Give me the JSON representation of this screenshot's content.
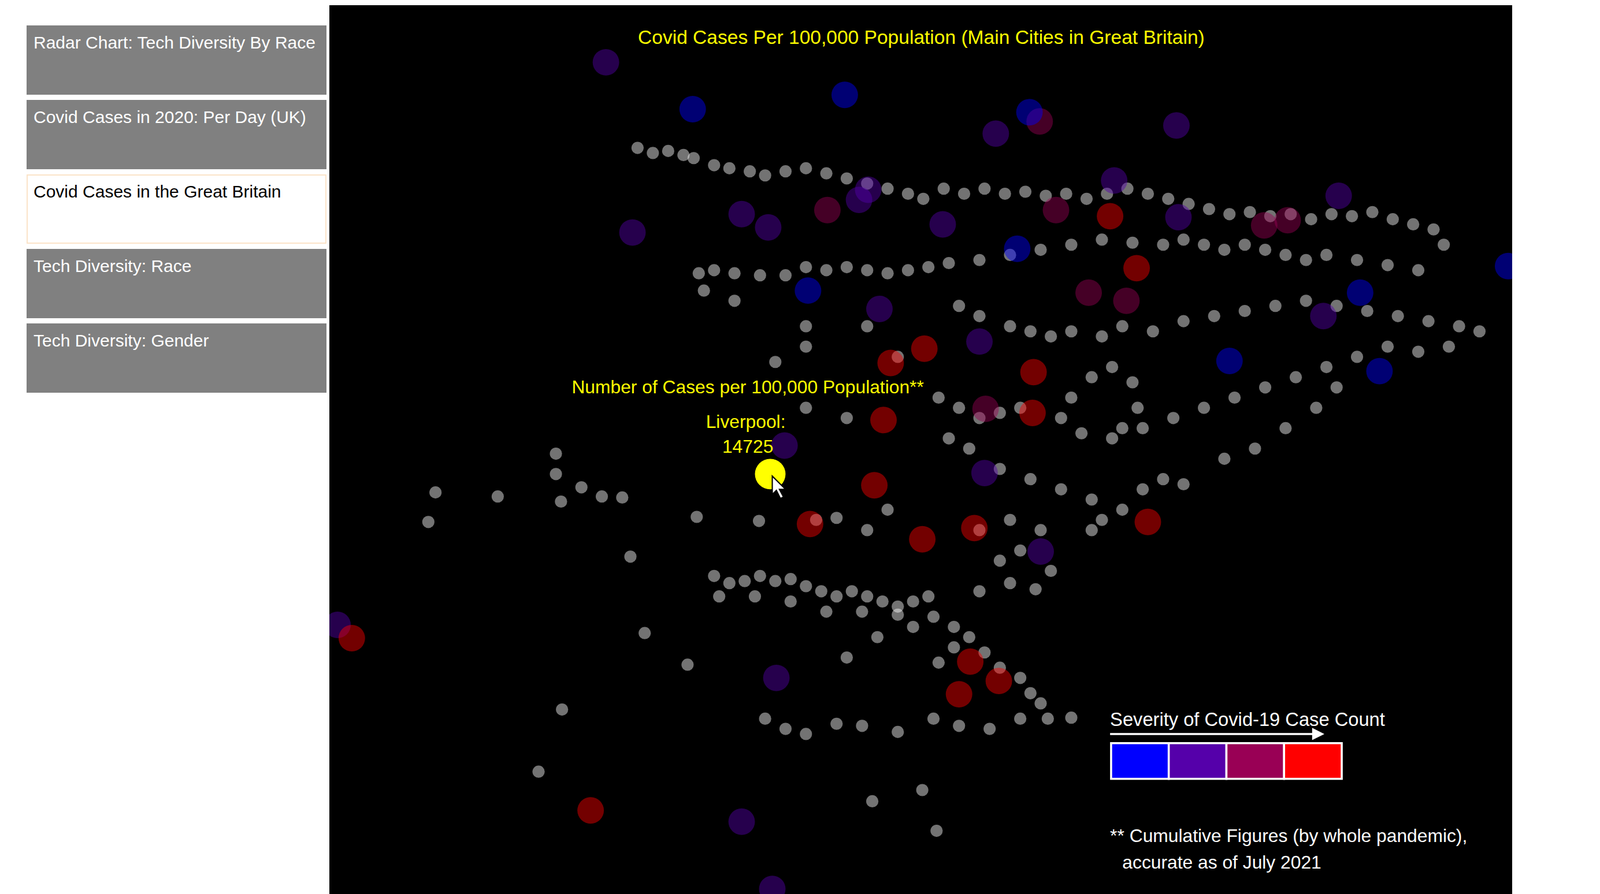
{
  "sidebar": {
    "items": [
      {
        "label": "Radar Chart: Tech Diversity By Race",
        "selected": false
      },
      {
        "label": "Covid Cases in 2020: Per Day (UK)",
        "selected": false
      },
      {
        "label": "Covid Cases in the Great Britain",
        "selected": true
      },
      {
        "label": "Tech Diversity: Race",
        "selected": false
      },
      {
        "label": "Tech Diversity: Gender",
        "selected": false
      }
    ]
  },
  "map": {
    "title": "Covid Cases Per 100,000 Population (Main Cities in Great Britain)",
    "tooltip": {
      "heading": "Number of Cases per 100,000 Population**",
      "city": "Liverpool:",
      "value": "14725",
      "point": [
        755,
        465
      ]
    },
    "towns": [
      [
        625,
        145
      ],
      [
        640,
        150
      ],
      [
        655,
        148
      ],
      [
        670,
        152
      ],
      [
        680,
        155
      ],
      [
        700,
        162
      ],
      [
        715,
        165
      ],
      [
        735,
        168
      ],
      [
        750,
        172
      ],
      [
        770,
        168
      ],
      [
        790,
        165
      ],
      [
        810,
        170
      ],
      [
        830,
        175
      ],
      [
        850,
        180
      ],
      [
        870,
        185
      ],
      [
        890,
        190
      ],
      [
        905,
        195
      ],
      [
        925,
        185
      ],
      [
        945,
        190
      ],
      [
        965,
        185
      ],
      [
        985,
        190
      ],
      [
        1005,
        188
      ],
      [
        1025,
        192
      ],
      [
        1045,
        190
      ],
      [
        1065,
        195
      ],
      [
        1085,
        190
      ],
      [
        1105,
        185
      ],
      [
        1125,
        190
      ],
      [
        1145,
        195
      ],
      [
        1165,
        200
      ],
      [
        1185,
        205
      ],
      [
        1205,
        210
      ],
      [
        1225,
        208
      ],
      [
        1245,
        212
      ],
      [
        1265,
        210
      ],
      [
        1285,
        215
      ],
      [
        1305,
        210
      ],
      [
        1325,
        212
      ],
      [
        1345,
        208
      ],
      [
        1365,
        215
      ],
      [
        1385,
        220
      ],
      [
        1405,
        225
      ],
      [
        1415,
        240
      ],
      [
        685,
        268
      ],
      [
        700,
        265
      ],
      [
        720,
        268
      ],
      [
        770,
        270
      ],
      [
        790,
        262
      ],
      [
        810,
        265
      ],
      [
        830,
        262
      ],
      [
        850,
        265
      ],
      [
        870,
        268
      ],
      [
        890,
        265
      ],
      [
        910,
        262
      ],
      [
        930,
        258
      ],
      [
        960,
        255
      ],
      [
        990,
        250
      ],
      [
        1020,
        245
      ],
      [
        1050,
        240
      ],
      [
        1080,
        235
      ],
      [
        1110,
        238
      ],
      [
        1140,
        240
      ],
      [
        1160,
        235
      ],
      [
        1180,
        240
      ],
      [
        1200,
        245
      ],
      [
        1220,
        240
      ],
      [
        1240,
        245
      ],
      [
        1260,
        250
      ],
      [
        1280,
        255
      ],
      [
        1300,
        250
      ],
      [
        1330,
        255
      ],
      [
        1360,
        260
      ],
      [
        1390,
        265
      ],
      [
        940,
        300
      ],
      [
        960,
        310
      ],
      [
        990,
        320
      ],
      [
        1010,
        325
      ],
      [
        1030,
        330
      ],
      [
        1050,
        325
      ],
      [
        1080,
        330
      ],
      [
        1100,
        320
      ],
      [
        1130,
        325
      ],
      [
        1160,
        315
      ],
      [
        1190,
        310
      ],
      [
        1220,
        305
      ],
      [
        1250,
        300
      ],
      [
        1280,
        295
      ],
      [
        1310,
        300
      ],
      [
        1340,
        305
      ],
      [
        1370,
        310
      ],
      [
        1400,
        315
      ],
      [
        1430,
        320
      ],
      [
        1450,
        325
      ],
      [
        1420,
        340
      ],
      [
        1390,
        345
      ],
      [
        1360,
        340
      ],
      [
        1330,
        350
      ],
      [
        1300,
        360
      ],
      [
        1270,
        370
      ],
      [
        1240,
        380
      ],
      [
        1210,
        390
      ],
      [
        1180,
        400
      ],
      [
        1150,
        410
      ],
      [
        1120,
        420
      ],
      [
        1090,
        430
      ],
      [
        1060,
        425
      ],
      [
        1040,
        410
      ],
      [
        1050,
        390
      ],
      [
        1070,
        370
      ],
      [
        1090,
        360
      ],
      [
        1110,
        375
      ],
      [
        1115,
        400
      ],
      [
        1100,
        420
      ],
      [
        920,
        390
      ],
      [
        940,
        400
      ],
      [
        960,
        410
      ],
      [
        980,
        405
      ],
      [
        1000,
        400
      ],
      [
        930,
        430
      ],
      [
        950,
        440
      ],
      [
        980,
        460
      ],
      [
        1010,
        470
      ],
      [
        1040,
        480
      ],
      [
        1070,
        490
      ],
      [
        1080,
        510
      ],
      [
        1070,
        520
      ],
      [
        1100,
        500
      ],
      [
        1120,
        480
      ],
      [
        1140,
        470
      ],
      [
        1160,
        475
      ],
      [
        1200,
        450
      ],
      [
        1230,
        440
      ],
      [
        1260,
        420
      ],
      [
        1290,
        400
      ],
      [
        1310,
        380
      ],
      [
        745,
        270
      ],
      [
        720,
        295
      ],
      [
        690,
        285
      ],
      [
        790,
        320
      ],
      [
        790,
        340
      ],
      [
        850,
        320
      ],
      [
        880,
        350
      ],
      [
        760,
        355
      ],
      [
        790,
        400
      ],
      [
        830,
        410
      ],
      [
        545,
        445
      ],
      [
        545,
        465
      ],
      [
        570,
        478
      ],
      [
        590,
        487
      ],
      [
        610,
        488
      ],
      [
        550,
        492
      ],
      [
        427,
        483
      ],
      [
        488,
        487
      ],
      [
        420,
        512
      ],
      [
        618,
        546
      ],
      [
        683,
        507
      ],
      [
        744,
        511
      ],
      [
        800,
        510
      ],
      [
        820,
        508
      ],
      [
        850,
        520
      ],
      [
        870,
        500
      ],
      [
        700,
        565
      ],
      [
        715,
        572
      ],
      [
        730,
        570
      ],
      [
        745,
        565
      ],
      [
        760,
        570
      ],
      [
        775,
        568
      ],
      [
        790,
        575
      ],
      [
        805,
        580
      ],
      [
        820,
        585
      ],
      [
        835,
        580
      ],
      [
        850,
        585
      ],
      [
        865,
        590
      ],
      [
        880,
        595
      ],
      [
        895,
        590
      ],
      [
        910,
        585
      ],
      [
        705,
        585
      ],
      [
        740,
        585
      ],
      [
        775,
        590
      ],
      [
        810,
        600
      ],
      [
        845,
        600
      ],
      [
        880,
        603
      ],
      [
        915,
        605
      ],
      [
        935,
        615
      ],
      [
        950,
        625
      ],
      [
        965,
        640
      ],
      [
        980,
        655
      ],
      [
        1000,
        665
      ],
      [
        1010,
        680
      ],
      [
        1020,
        690
      ],
      [
        935,
        635
      ],
      [
        920,
        650
      ],
      [
        632,
        621
      ],
      [
        674,
        652
      ],
      [
        551,
        696
      ],
      [
        528,
        757
      ],
      [
        750,
        705
      ],
      [
        770,
        715
      ],
      [
        790,
        720
      ],
      [
        820,
        710
      ],
      [
        845,
        712
      ],
      [
        880,
        718
      ],
      [
        915,
        705
      ],
      [
        940,
        712
      ],
      [
        970,
        715
      ],
      [
        1000,
        705
      ],
      [
        1027,
        705
      ],
      [
        1050,
        704
      ],
      [
        855,
        786
      ],
      [
        904,
        775
      ],
      [
        918,
        815
      ],
      [
        830,
        645
      ],
      [
        860,
        625
      ],
      [
        895,
        615
      ],
      [
        960,
        580
      ],
      [
        990,
        572
      ],
      [
        1015,
        578
      ],
      [
        1030,
        560
      ],
      [
        960,
        520
      ],
      [
        990,
        510
      ],
      [
        1020,
        520
      ],
      [
        1000,
        540
      ],
      [
        980,
        550
      ]
    ],
    "cities": [
      {
        "point": [
          594,
          61
        ],
        "color": "#5500aa"
      },
      {
        "point": [
          679,
          107
        ],
        "color": "#0000ff"
      },
      {
        "point": [
          828,
          93
        ],
        "color": "#0000ff"
      },
      {
        "point": [
          976,
          131
        ],
        "color": "#5500aa"
      },
      {
        "point": [
          1019,
          119
        ],
        "color": "#990055"
      },
      {
        "point": [
          1009,
          110
        ],
        "color": "#0000ff"
      },
      {
        "point": [
          1153,
          123
        ],
        "color": "#5500aa"
      },
      {
        "point": [
          620,
          228
        ],
        "color": "#5500aa"
      },
      {
        "point": [
          727,
          210
        ],
        "color": "#5500aa"
      },
      {
        "point": [
          753,
          223
        ],
        "color": "#5500aa"
      },
      {
        "point": [
          811,
          206
        ],
        "color": "#990055"
      },
      {
        "point": [
          842,
          196
        ],
        "color": "#5500aa"
      },
      {
        "point": [
          851,
          186
        ],
        "color": "#5500aa"
      },
      {
        "point": [
          924,
          220
        ],
        "color": "#5500aa"
      },
      {
        "point": [
          1035,
          206
        ],
        "color": "#990055"
      },
      {
        "point": [
          1088,
          212
        ],
        "color": "#ff0000"
      },
      {
        "point": [
          1155,
          213
        ],
        "color": "#5500aa"
      },
      {
        "point": [
          1239,
          221
        ],
        "color": "#990055"
      },
      {
        "point": [
          1262,
          216
        ],
        "color": "#990055"
      },
      {
        "point": [
          1312,
          192
        ],
        "color": "#5500aa"
      },
      {
        "point": [
          1092,
          177
        ],
        "color": "#5500aa"
      },
      {
        "point": [
          1114,
          263
        ],
        "color": "#ff0000"
      },
      {
        "point": [
          1104,
          295
        ],
        "color": "#990055"
      },
      {
        "point": [
          1067,
          287
        ],
        "color": "#990055"
      },
      {
        "point": [
          997,
          244
        ],
        "color": "#0000ff"
      },
      {
        "point": [
          792,
          285
        ],
        "color": "#0000ff"
      },
      {
        "point": [
          862,
          303
        ],
        "color": "#5500aa"
      },
      {
        "point": [
          873,
          356
        ],
        "color": "#ff0000"
      },
      {
        "point": [
          906,
          342
        ],
        "color": "#ff0000"
      },
      {
        "point": [
          960,
          335
        ],
        "color": "#5500aa"
      },
      {
        "point": [
          1013,
          365
        ],
        "color": "#ff0000"
      },
      {
        "point": [
          1012,
          405
        ],
        "color": "#ff0000"
      },
      {
        "point": [
          966,
          401
        ],
        "color": "#990055"
      },
      {
        "point": [
          866,
          412
        ],
        "color": "#ff0000"
      },
      {
        "point": [
          769,
          437
        ],
        "color": "#5500aa"
      },
      {
        "point": [
          857,
          476
        ],
        "color": "#ff0000"
      },
      {
        "point": [
          794,
          514
        ],
        "color": "#ff0000"
      },
      {
        "point": [
          904,
          529
        ],
        "color": "#ff0000"
      },
      {
        "point": [
          955,
          518
        ],
        "color": "#ff0000"
      },
      {
        "point": [
          965,
          464
        ],
        "color": "#5500aa"
      },
      {
        "point": [
          1125,
          512
        ],
        "color": "#ff0000"
      },
      {
        "point": [
          1020,
          541
        ],
        "color": "#5500aa"
      },
      {
        "point": [
          1333,
          287
        ],
        "color": "#0000ff"
      },
      {
        "point": [
          1297,
          310
        ],
        "color": "#5500aa"
      },
      {
        "point": [
          1352,
          364
        ],
        "color": "#0000ff"
      },
      {
        "point": [
          1205,
          354
        ],
        "color": "#0000ff"
      },
      {
        "point": [
          1478,
          261
        ],
        "color": "#0000ff"
      },
      {
        "point": [
          331,
          613
        ],
        "color": "#5500aa"
      },
      {
        "point": [
          345,
          626
        ],
        "color": "#ff0000"
      },
      {
        "point": [
          761,
          665
        ],
        "color": "#5500aa"
      },
      {
        "point": [
          951,
          649
        ],
        "color": "#ff0000"
      },
      {
        "point": [
          979,
          668
        ],
        "color": "#ff0000"
      },
      {
        "point": [
          940,
          681
        ],
        "color": "#ff0000"
      },
      {
        "point": [
          579,
          795
        ],
        "color": "#ff0000"
      },
      {
        "point": [
          727,
          806
        ],
        "color": "#5500aa"
      },
      {
        "point": [
          757,
          872
        ],
        "color": "#5500aa"
      }
    ],
    "legend": {
      "title": "Severity of Covid-19 Case Count",
      "colors": [
        "#0000ff",
        "#5500aa",
        "#990055",
        "#ff0000"
      ]
    },
    "footnote": [
      "** Cumulative Figures (by whole pandemic),",
      "accurate as of July 2021"
    ]
  }
}
